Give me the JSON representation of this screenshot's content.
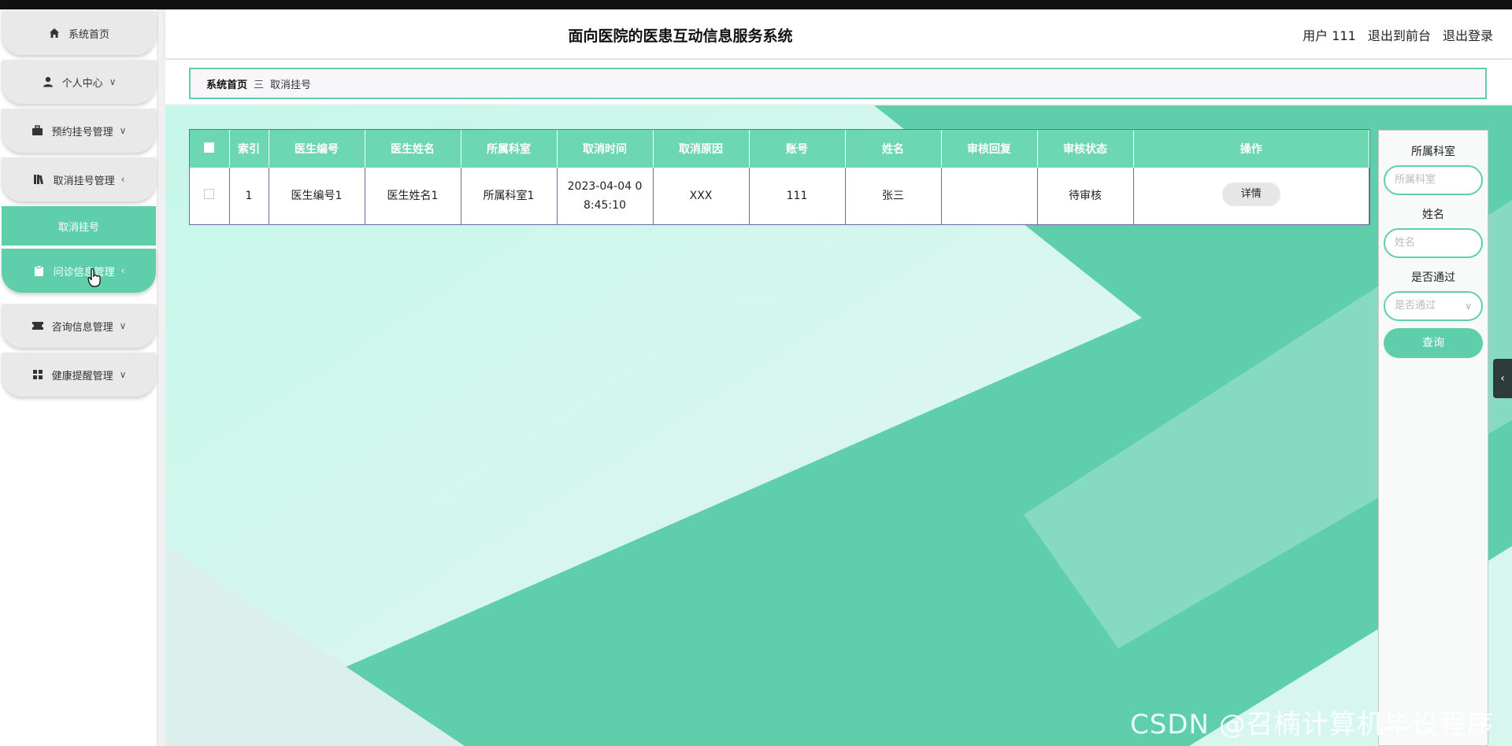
{
  "header": {
    "title": "面向医院的医患互动信息服务系统",
    "user": "用户 111",
    "to_front": "退出到前台",
    "logout": "退出登录"
  },
  "sidebar": {
    "items": [
      {
        "label": "系统首页",
        "icon": "home-icon"
      },
      {
        "label": "个人中心",
        "icon": "user-icon",
        "chevron": "∨"
      },
      {
        "label": "预约挂号管理",
        "icon": "briefcase-icon",
        "chevron": "∨"
      },
      {
        "label": "取消挂号管理",
        "icon": "book-icon",
        "chevron": "‹"
      },
      {
        "label": "问诊信息管理",
        "icon": "clipboard-icon",
        "chevron": "‹"
      },
      {
        "label": "咨询信息管理",
        "icon": "ticket-icon",
        "chevron": "∨"
      },
      {
        "label": "健康提醒管理",
        "icon": "grid-icon",
        "chevron": "∨"
      }
    ],
    "submenu": {
      "label": "取消挂号"
    }
  },
  "breadcrumb": {
    "home": "系统首页",
    "separator": "三",
    "current": "取消挂号"
  },
  "table": {
    "columns": [
      "索引",
      "医生编号",
      "医生姓名",
      "所属科室",
      "取消时间",
      "取消原因",
      "账号",
      "姓名",
      "审核回复",
      "审核状态",
      "操作"
    ],
    "rows": [
      {
        "index": "1",
        "doctor_no": "医生编号1",
        "doctor_name": "医生姓名1",
        "department": "所属科室1",
        "cancel_time": "2023-04-04 08:45:10",
        "reason": "XXX",
        "account": "111",
        "name": "张三",
        "reply": "",
        "status": "待审核",
        "action": "详情"
      }
    ]
  },
  "search": {
    "dept_label": "所属科室",
    "dept_placeholder": "所属科室",
    "name_label": "姓名",
    "name_placeholder": "姓名",
    "pass_label": "是否通过",
    "pass_placeholder": "是否通过",
    "button": "查询"
  },
  "colors": {
    "accent": "#5fcfab",
    "header_row": "#6dd6b3",
    "background_light": "#d8f6ee"
  },
  "watermark": "CSDN @召楠计算机毕设程序",
  "side_tab": "‹"
}
